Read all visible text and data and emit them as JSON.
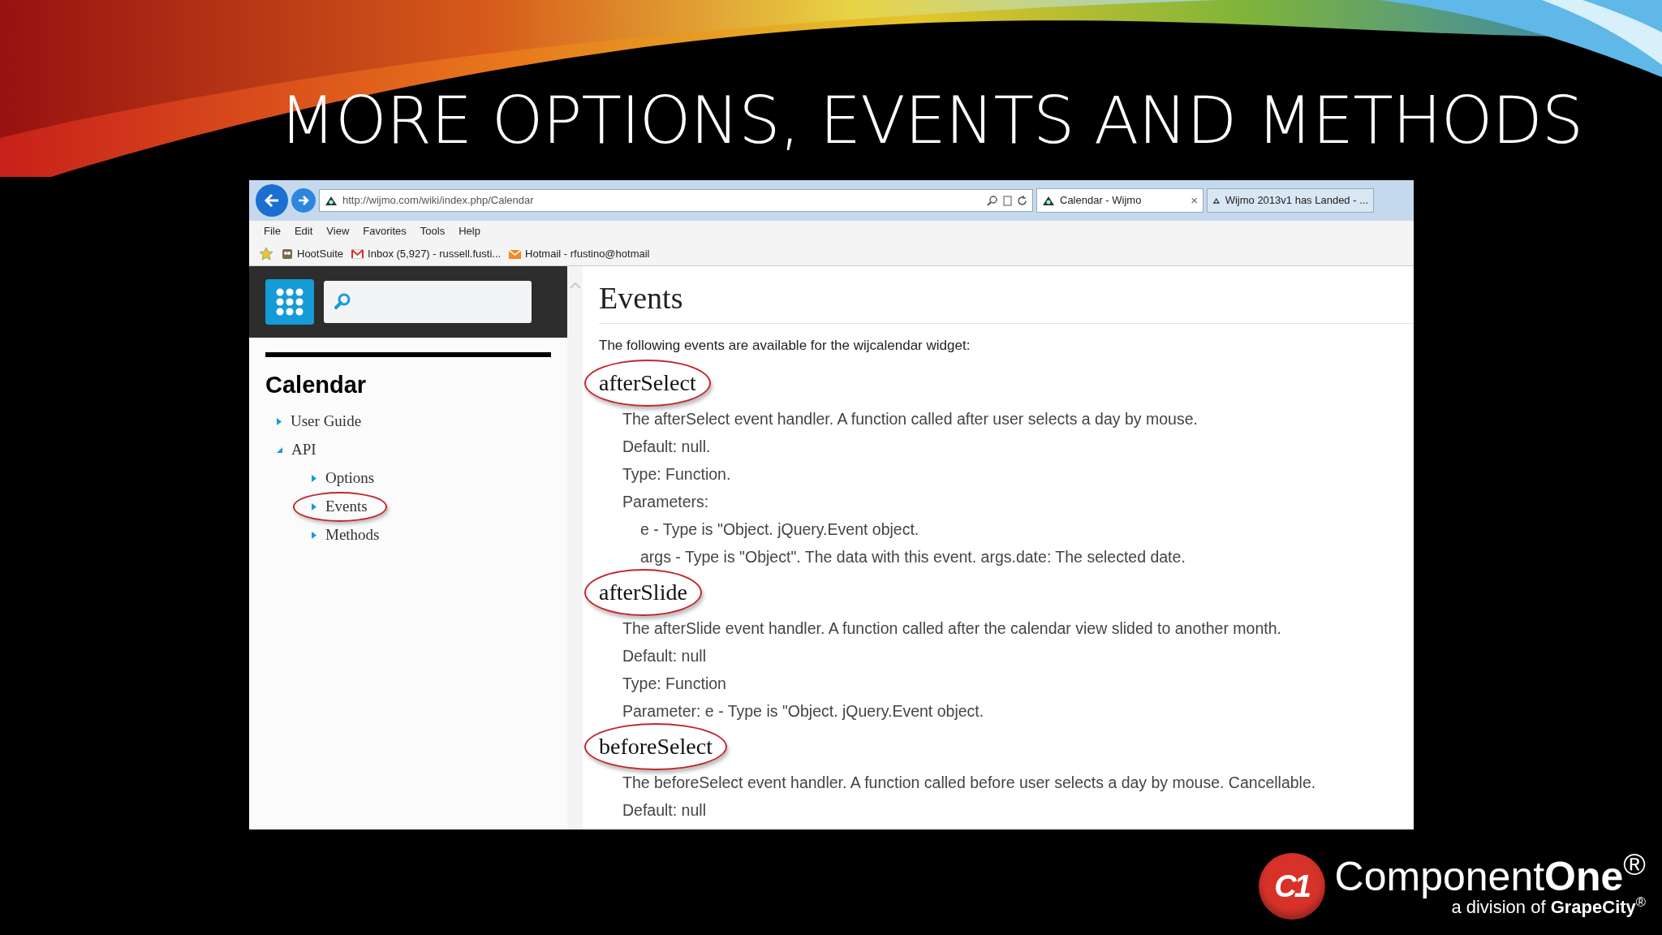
{
  "slide": {
    "title": "MORE OPTIONS, EVENTS AND METHODS"
  },
  "browser": {
    "address": "http://wijmo.com/wiki/index.php/Calendar",
    "tabs": [
      {
        "label": "Calendar - Wijmo",
        "selected": true,
        "close": "×"
      },
      {
        "label": "Wijmo 2013v1 has Landed - ...",
        "selected": false
      }
    ],
    "menu": [
      "File",
      "Edit",
      "View",
      "Favorites",
      "Tools",
      "Help"
    ],
    "favorites": [
      {
        "label": "HootSuite",
        "kind": "hoot"
      },
      {
        "label": "Inbox (5,927) - russell.fusti...",
        "kind": "mail"
      },
      {
        "label": "Hotmail - rfustino@hotmail",
        "kind": "hotmail"
      }
    ]
  },
  "sidebar": {
    "title": "Calendar",
    "tree": [
      {
        "label": "User Guide",
        "expanded": false,
        "circled": false
      },
      {
        "label": "API",
        "expanded": true,
        "circled": false,
        "children": [
          {
            "label": "Options",
            "expanded": false,
            "circled": false
          },
          {
            "label": "Events",
            "expanded": false,
            "circled": true
          },
          {
            "label": "Methods",
            "expanded": false,
            "circled": false
          }
        ]
      }
    ]
  },
  "page": {
    "heading": "Events",
    "intro": "The following events are available for the wijcalendar widget:",
    "events": [
      {
        "name": "afterSelect",
        "circled": true,
        "lines": [
          {
            "text": "The afterSelect event handler. A function called after user selects a day by mouse."
          },
          {
            "text": "Default: null."
          },
          {
            "text": "Type: Function."
          },
          {
            "text": "Parameters:",
            "children": [
              {
                "text": "e - Type is \"Object. jQuery.Event object."
              },
              {
                "text": "args - Type is \"Object\". The data with this event. args.date: The selected date."
              }
            ]
          }
        ]
      },
      {
        "name": "afterSlide",
        "circled": true,
        "lines": [
          {
            "text": "The afterSlide event handler. A function called after the calendar view slided to another month."
          },
          {
            "text": "Default: null"
          },
          {
            "text": "Type: Function"
          },
          {
            "text": "Parameter: e - Type is \"Object. jQuery.Event object."
          }
        ]
      },
      {
        "name": "beforeSelect",
        "circled": true,
        "lines": [
          {
            "text": "The beforeSelect event handler. A function called before user selects a day by mouse. Cancellable."
          },
          {
            "text": "Default: null"
          }
        ]
      }
    ]
  },
  "logo": {
    "mark": "C1",
    "name": "Component**One**$^{®}$",
    "tagline": "a division of **GrapeCity**$^{®}$"
  }
}
